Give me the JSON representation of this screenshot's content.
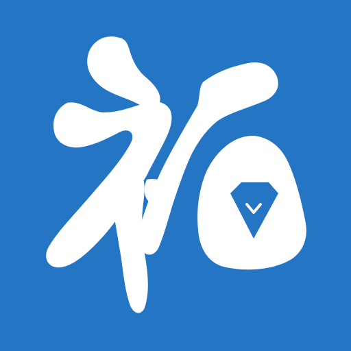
{
  "app_icon": {
    "glyph": "拓",
    "background_color": "#2575c5",
    "glyph_color": "#ffffff",
    "gem_icon": "diamond-icon",
    "gem_color": "#2575c5"
  }
}
